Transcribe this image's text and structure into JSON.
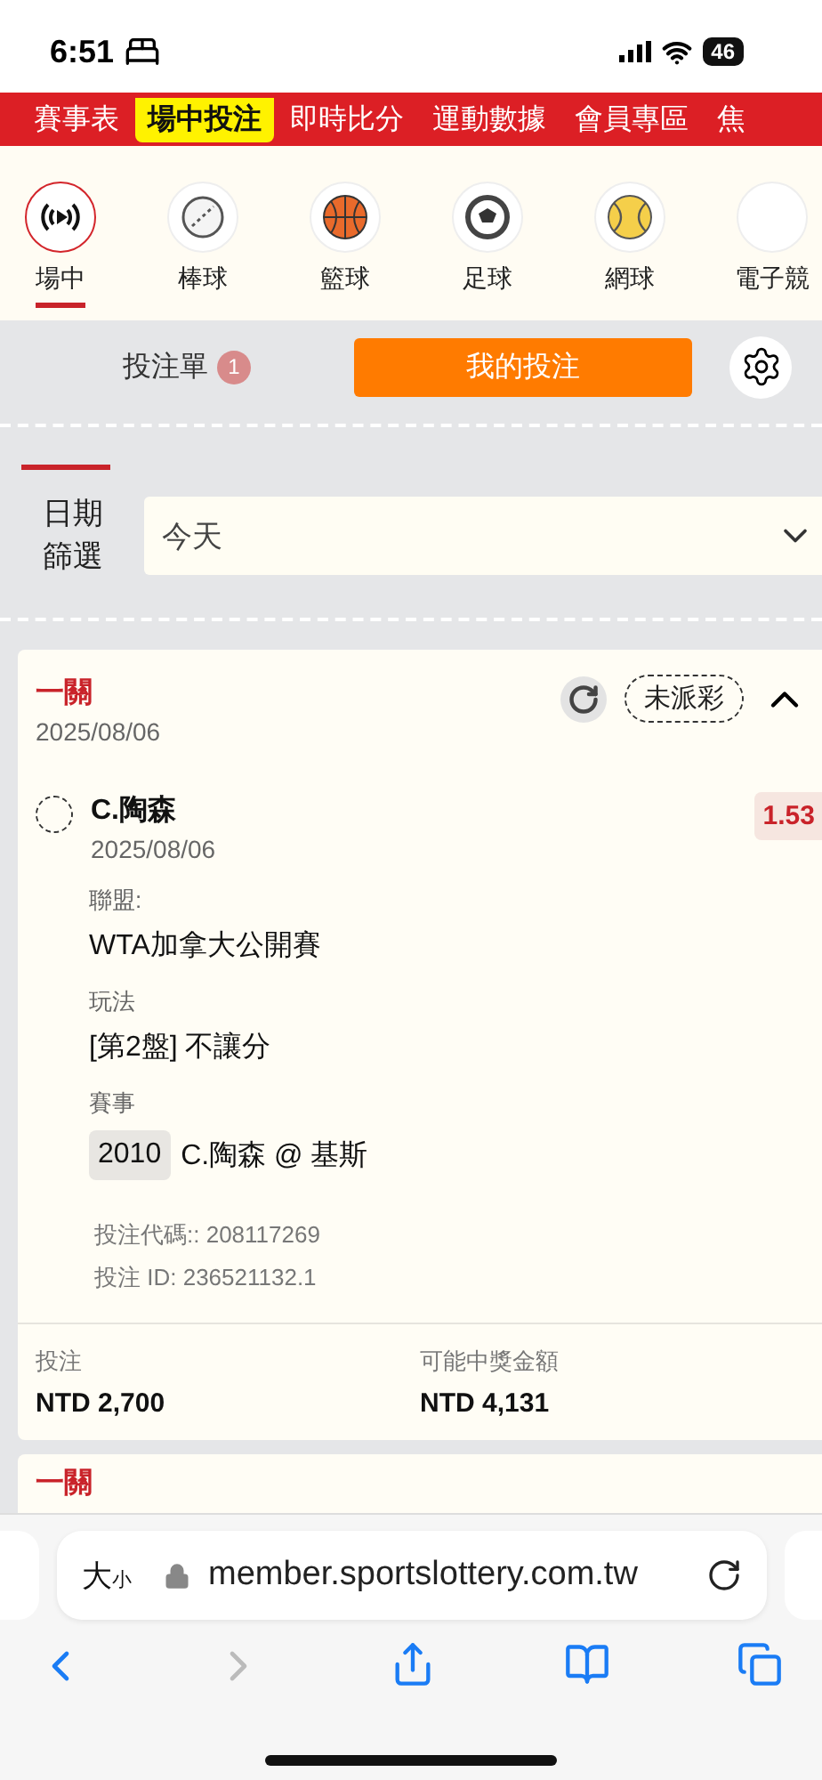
{
  "status_bar": {
    "time": "6:51",
    "battery": "46"
  },
  "top_nav": [
    {
      "label": "賽事表",
      "selected": false
    },
    {
      "label": "場中投注",
      "selected": true
    },
    {
      "label": "即時比分",
      "selected": false
    },
    {
      "label": "運動數據",
      "selected": false
    },
    {
      "label": "會員專區",
      "selected": false
    },
    {
      "label": "焦",
      "selected": false
    }
  ],
  "sports": [
    {
      "label": "場中",
      "kind": "live",
      "selected": true
    },
    {
      "label": "棒球",
      "kind": "baseball",
      "selected": false
    },
    {
      "label": "籃球",
      "kind": "basketball",
      "selected": false
    },
    {
      "label": "足球",
      "kind": "soccer",
      "selected": false
    },
    {
      "label": "網球",
      "kind": "tennis",
      "selected": false
    },
    {
      "label": "電子競",
      "kind": "esports",
      "selected": false
    }
  ],
  "bet_tabs": [
    {
      "label": "投注單",
      "badge": "1",
      "selected": false
    },
    {
      "label": "我的投注",
      "selected": true
    }
  ],
  "date_filter": {
    "label": "日期篩選",
    "value": "今天"
  },
  "bets": [
    {
      "type": "一關",
      "date": "2025/08/06",
      "status": "未派彩",
      "expanded": true,
      "selection": {
        "name": "C.陶森",
        "date": "2025/08/06",
        "odds": "1.53"
      },
      "details": [
        {
          "label": "聯盟:",
          "value": "WTA加拿大公開賽"
        },
        {
          "label": "玩法",
          "value": "[第2盤] 不讓分"
        },
        {
          "label": "賽事",
          "code": "2010",
          "value": "C.陶森 @ 基斯"
        }
      ],
      "bet_code": "投注代碼:: 208117269",
      "bet_id": "投注 ID: 236521132.1",
      "stake_label": "投注",
      "stake": "NTD 2,700",
      "payout_label": "可能中獎金額",
      "payout": "NTD 4,131"
    },
    {
      "type": "一關"
    }
  ],
  "browser": {
    "text_size": "大小",
    "url": "member.sportslottery.com.tw"
  }
}
